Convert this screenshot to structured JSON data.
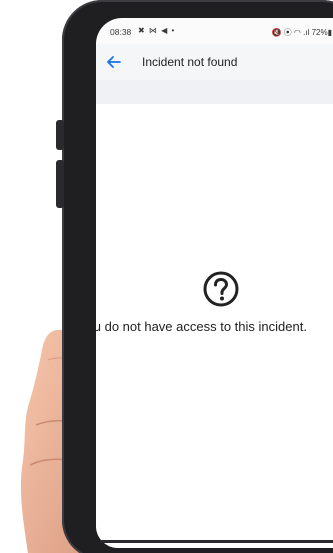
{
  "status_bar": {
    "time": "08:38",
    "left_icons": "✖ ⋈ ◀ •",
    "right_icons": "🔇 ⦿ ◠ .ıl 72%▮"
  },
  "app_bar": {
    "back_icon": "back-arrow-icon",
    "title": "Incident not found"
  },
  "content": {
    "help_icon": "question-circle-icon",
    "message": "You do not have access to this incident."
  },
  "colors": {
    "accent": "#1a73e8",
    "text": "#222222",
    "appbar_bg": "#f5f6f8",
    "phone_frame": "#1f1f21"
  }
}
